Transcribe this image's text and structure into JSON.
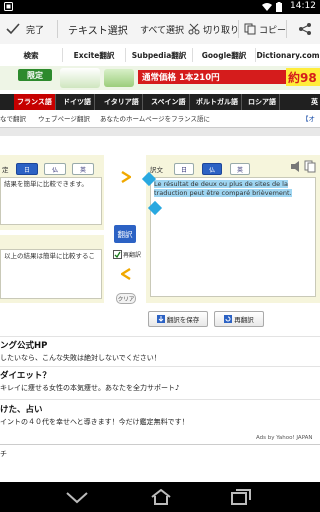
{
  "status": {
    "time": "14:12"
  },
  "actionbar": {
    "done": "完了",
    "title": "テキスト選択",
    "select_all": "すべて選択",
    "cut": "切り取り",
    "copy": "コピー"
  },
  "tabs": [
    "検索",
    "Excite翻訳",
    "Subpedia翻訳",
    "Google翻訳",
    "Dictionary.com"
  ],
  "ad": {
    "left_text": "限定",
    "center_text": "通常価格 1本210円",
    "right_text": "約98"
  },
  "langnav": {
    "items": [
      "フランス語",
      "ドイツ語",
      "イタリア語",
      "スペイン語",
      "ポルトガル語",
      "ロシア語"
    ],
    "right": "英"
  },
  "subnav": {
    "items": [
      "なで翻訳",
      "ウェブページ翻訳",
      "あなたのホームページをフランス語に"
    ],
    "right": "【オ"
  },
  "translate": {
    "source_label": "定",
    "source_btns": [
      "日",
      "仏",
      "英"
    ],
    "source_text": "結果を簡単に比較できます。",
    "source_text2": "以上の結果は簡単に比較するこ",
    "target_label": "訳文",
    "target_btns": [
      "日",
      "仏",
      "英"
    ],
    "target_text": "Le résultat de deux ou plus de sites de la traduction peut être comparé brièvement.",
    "translate_btn": "翻訳",
    "retranslate_check": "再翻訳",
    "clear_btn": "クリア",
    "save_btn": "翻訳を保存",
    "retranslate_btn": "再翻訳"
  },
  "list": [
    {
      "title": "ング公式HP",
      "desc": "したいなら、こんな失敗は絶対しないでください！"
    },
    {
      "title": "ダイエット？",
      "desc": "キレイに痩せる女性の本気痩せ。あなたを全力サポート♪"
    },
    {
      "title": "けた、占い",
      "desc": "イントの４０代を幸せへと導きます！今だけ鑑定無料です！"
    }
  ],
  "ads_by": "Ads by Yahoo! JAPAN",
  "footer_text": "チ"
}
